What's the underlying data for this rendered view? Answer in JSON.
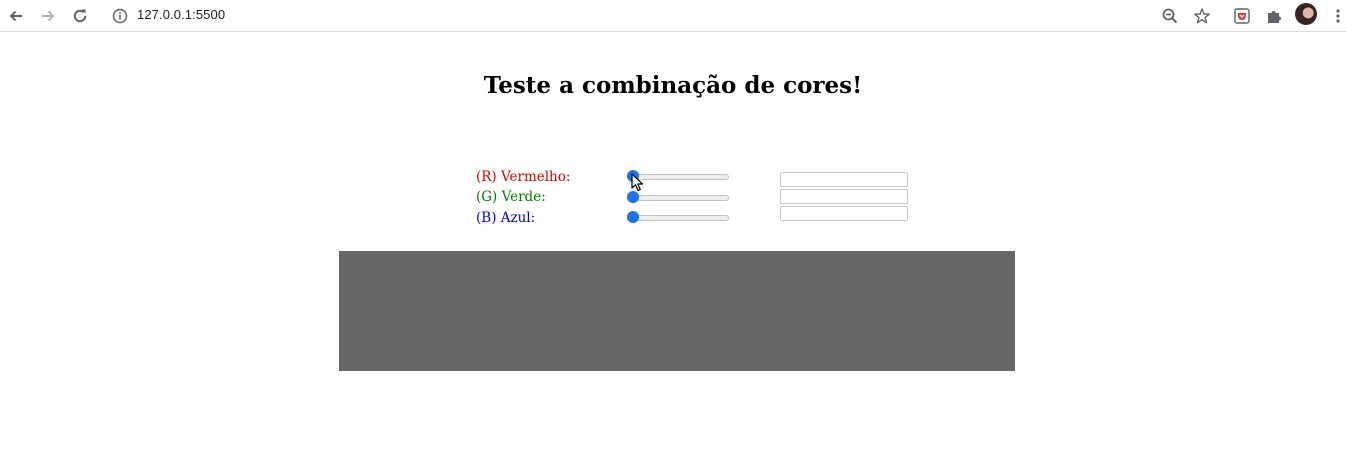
{
  "browser": {
    "url": "127.0.0.1:5500",
    "icons": [
      "back-icon",
      "forward-icon",
      "reload-icon",
      "info-icon",
      "zoom-icon",
      "star-icon",
      "extension-pocket-icon",
      "puzzle-icon",
      "avatar",
      "menu-icon"
    ]
  },
  "page": {
    "title": "Teste a combinação de cores!",
    "sliders": [
      {
        "label": "(R) Vermelho:",
        "color": "#e00000",
        "value": 0,
        "min": 0,
        "max": 255,
        "input_value": ""
      },
      {
        "label": "(G) Verde:",
        "color": "#008000",
        "value": 0,
        "min": 0,
        "max": 255,
        "input_value": ""
      },
      {
        "label": "(B) Azul:",
        "color": "#0000e0",
        "value": 0,
        "min": 0,
        "max": 255,
        "input_value": ""
      }
    ],
    "preview_color": "#666666",
    "accent": "#1a73e8"
  }
}
